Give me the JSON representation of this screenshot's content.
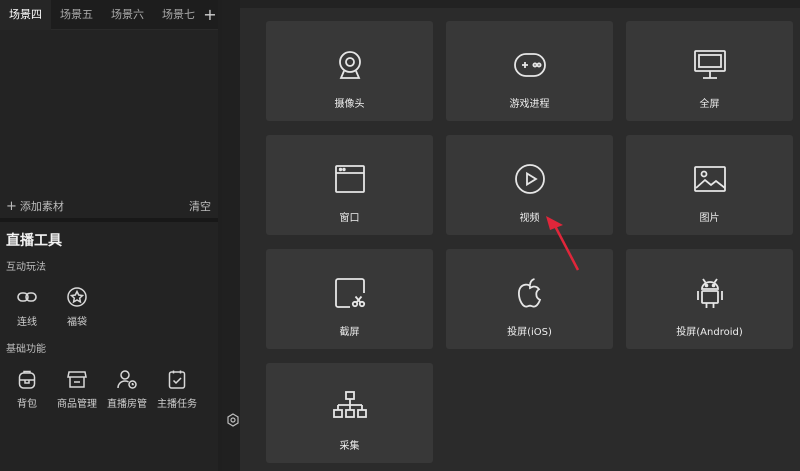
{
  "scene_tabs": [
    "场景四",
    "场景五",
    "场景六",
    "场景七"
  ],
  "scene_tab_add": "+",
  "scene_footer": {
    "add_material": "添加素材",
    "clear": "清空"
  },
  "live_tools": {
    "title": "直播工具",
    "interactive_label": "互动玩法",
    "interactive_items": [
      {
        "label": "连线",
        "icon": "link-icon"
      },
      {
        "label": "福袋",
        "icon": "star-bag-icon"
      }
    ],
    "basic_label": "基础功能",
    "basic_items": [
      {
        "label": "背包",
        "icon": "backpack-icon"
      },
      {
        "label": "商品管理",
        "icon": "store-icon"
      },
      {
        "label": "直播房管",
        "icon": "user-admin-icon"
      },
      {
        "label": "主播任务",
        "icon": "task-icon"
      }
    ]
  },
  "sources": [
    {
      "label": "摄像头",
      "icon": "webcam-icon"
    },
    {
      "label": "游戏进程",
      "icon": "gamepad-icon"
    },
    {
      "label": "全屏",
      "icon": "monitor-icon"
    },
    {
      "label": "窗口",
      "icon": "window-icon"
    },
    {
      "label": "视频",
      "icon": "play-icon"
    },
    {
      "label": "图片",
      "icon": "image-icon"
    },
    {
      "label": "截屏",
      "icon": "crop-icon"
    },
    {
      "label": "投屏(iOS)",
      "icon": "apple-icon"
    },
    {
      "label": "投屏(Android)",
      "icon": "android-icon"
    },
    {
      "label": "采集",
      "icon": "network-icon"
    }
  ],
  "colors": {
    "arrow": "#e0263a",
    "card": "#383838",
    "background": "#2b2b2b"
  }
}
